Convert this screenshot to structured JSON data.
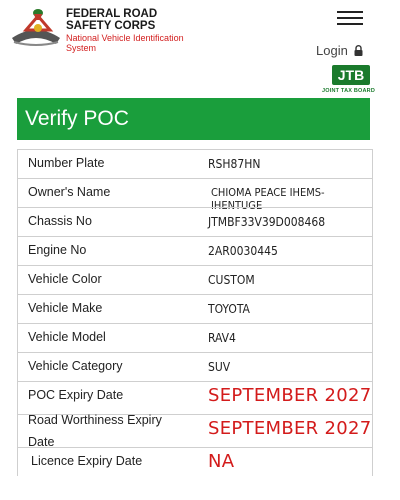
{
  "header": {
    "org_name": "FEDERAL ROAD SAFETY CORPS",
    "org_subtitle": "National Vehicle Identification System",
    "login_label": "Login",
    "partner_logo_text": "JTB",
    "partner_caption": "JOINT TAX BOARD"
  },
  "banner": {
    "title": "Verify POC"
  },
  "rows": [
    {
      "label": "Number Plate",
      "value": "RSH87HN"
    },
    {
      "label": "Owner's Name",
      "value": "CHIOMA PEACE IHEMS-IHENTUGE"
    },
    {
      "label": "Chassis No",
      "value": "JTMBF33V39D008468"
    },
    {
      "label": "Engine No",
      "value": "2AR0030445"
    },
    {
      "label": "Vehicle Color",
      "value": "CUSTOM"
    },
    {
      "label": "Vehicle Make",
      "value": "TOYOTA"
    },
    {
      "label": "Vehicle Model",
      "value": "RAV4"
    },
    {
      "label": "Vehicle Category",
      "value": "SUV"
    },
    {
      "label": "POC Expiry Date",
      "value": "SEPTEMBER 2027"
    },
    {
      "label": "Road Worthiness Expiry Date",
      "value": "SEPTEMBER 2027"
    },
    {
      "label": "Licence Expiry Date",
      "value": "NA"
    }
  ],
  "colors": {
    "brand_green": "#1a9e3c",
    "alert_red": "#d31b1b"
  },
  "icons": {
    "menu": "hamburger-icon",
    "login": "lock-icon"
  }
}
